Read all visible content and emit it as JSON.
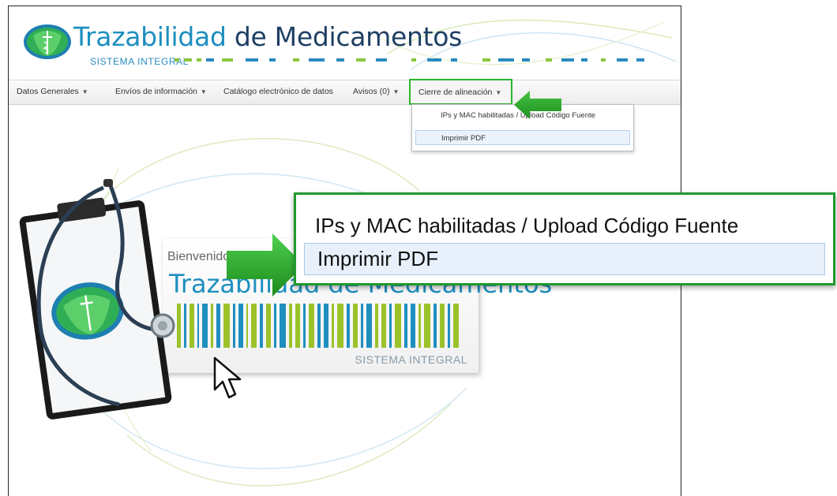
{
  "header": {
    "brand_part1": "Trazabilidad",
    "brand_part2": "de Medicamentos",
    "subtitle": "SISTEMA INTEGRAL"
  },
  "navbar": {
    "items": [
      {
        "label": "Datos Generales",
        "dropdown": true
      },
      {
        "label": "Envíos de información",
        "dropdown": true
      },
      {
        "label": "Catálogo electrónico de datos",
        "dropdown": false
      },
      {
        "label": "Avisos (0)",
        "dropdown": true
      },
      {
        "label": "Cierre de alineación",
        "dropdown": true,
        "active": true
      }
    ]
  },
  "dropdown": {
    "items": [
      "IPs y MAC habilitadas / Upload Código Fuente",
      "Imprimir PDF"
    ],
    "highlighted_index": 1
  },
  "banner": {
    "welcome": "Bienvenido",
    "title": "Trazabilidad de Medicamentos",
    "subtitle": "SISTEMA INTEGRAL"
  },
  "callout": {
    "item1": "IPs y MAC habilitadas / Upload Código Fuente",
    "item2": "Imprimir PDF"
  },
  "colors": {
    "accent_green": "#2bb52b",
    "brand_blue": "#1e8fbf",
    "brand_dark": "#1f3f63",
    "lime": "#9cc22a"
  },
  "icons": [
    "logo-emblem-icon",
    "caret-down-icon",
    "green-arrow-icon",
    "mouse-cursor-icon",
    "clipboard-stethoscope-illustration"
  ]
}
